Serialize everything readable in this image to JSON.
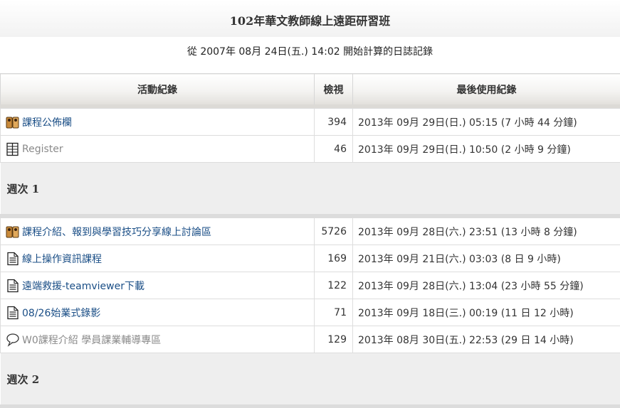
{
  "page": {
    "course_title": "102年華文教師線上遠距研習班",
    "subtitle": "從 2007年 08月 24日(五.) 14:02 開始計算的日誌記錄"
  },
  "table": {
    "headers": {
      "activity": "活動紀錄",
      "views": "檢視",
      "last_access": "最後使用紀錄"
    },
    "top_rows": [
      {
        "icon": "forum-icon",
        "label": "課程公佈欄",
        "views": "394",
        "last_access": "2013年 09月 29日(日.) 05:15 (7 小時 44 分鐘)",
        "dimmed": false
      },
      {
        "icon": "database-icon",
        "label": "Register",
        "views": "46",
        "last_access": "2013年 09月 29日(日.) 10:50 (2 小時 9 分鐘)",
        "dimmed": true
      }
    ],
    "sections": [
      {
        "title": "週次 1",
        "rows": [
          {
            "icon": "forum-icon",
            "label": "課程介紹、報到與學習技巧分享線上討論區",
            "views": "5726",
            "last_access": "2013年 09月 28日(六.) 23:51 (13 小時 8 分鐘)",
            "dimmed": false
          },
          {
            "icon": "page-icon",
            "label": "線上操作資訊課程",
            "views": "169",
            "last_access": "2013年 09月 21日(六.) 03:03 (8 日 9 小時)",
            "dimmed": false
          },
          {
            "icon": "page-icon",
            "label": "遠端救援-teamviewer下載",
            "views": "122",
            "last_access": "2013年 09月 28日(六.) 13:04 (23 小時 55 分鐘)",
            "dimmed": false
          },
          {
            "icon": "page-icon",
            "label": "08/26始業式錄影",
            "views": "71",
            "last_access": "2013年 09月 18日(三.) 00:19 (11 日 12 小時)",
            "dimmed": false
          },
          {
            "icon": "chat-icon",
            "label": "W0課程介紹 學員課業輔導專區",
            "views": "129",
            "last_access": "2013年 08月 30日(五.) 22:53 (29 日 14 小時)",
            "dimmed": true
          }
        ]
      },
      {
        "title": "週次 2",
        "rows": []
      }
    ]
  }
}
